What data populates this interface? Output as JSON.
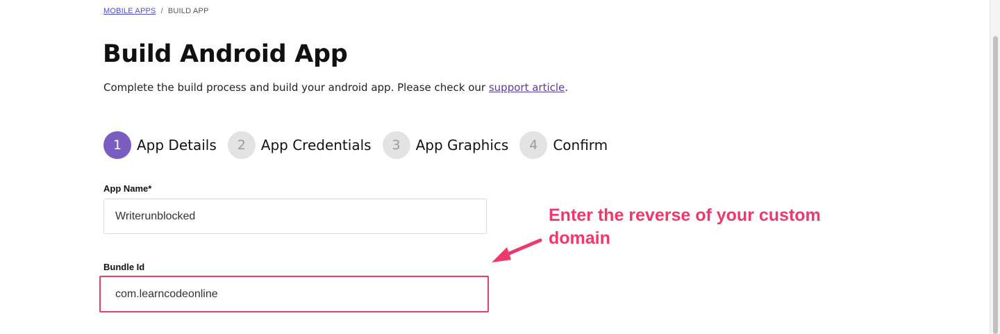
{
  "breadcrumb": {
    "parent": "MOBILE APPS",
    "separator": "/",
    "current": "BUILD APP"
  },
  "page": {
    "title": "Build Android App",
    "subtitle_prefix": "Complete the build process and build your android app. Please check our ",
    "subtitle_link": "support article",
    "subtitle_suffix": "."
  },
  "steps": [
    {
      "number": "1",
      "label": "App Details",
      "active": true
    },
    {
      "number": "2",
      "label": "App Credentials",
      "active": false
    },
    {
      "number": "3",
      "label": "App Graphics",
      "active": false
    },
    {
      "number": "4",
      "label": "Confirm",
      "active": false
    }
  ],
  "form": {
    "app_name_label": "App Name*",
    "app_name_value": "Writerunblocked",
    "bundle_id_label": "Bundle Id",
    "bundle_id_value": "com.learncodeonline"
  },
  "annotation": {
    "text": "Enter the reverse of your custom domain"
  },
  "colors": {
    "accent": "#7b5cc0",
    "annotation": "#f0386b",
    "link": "#5b3aa6"
  }
}
